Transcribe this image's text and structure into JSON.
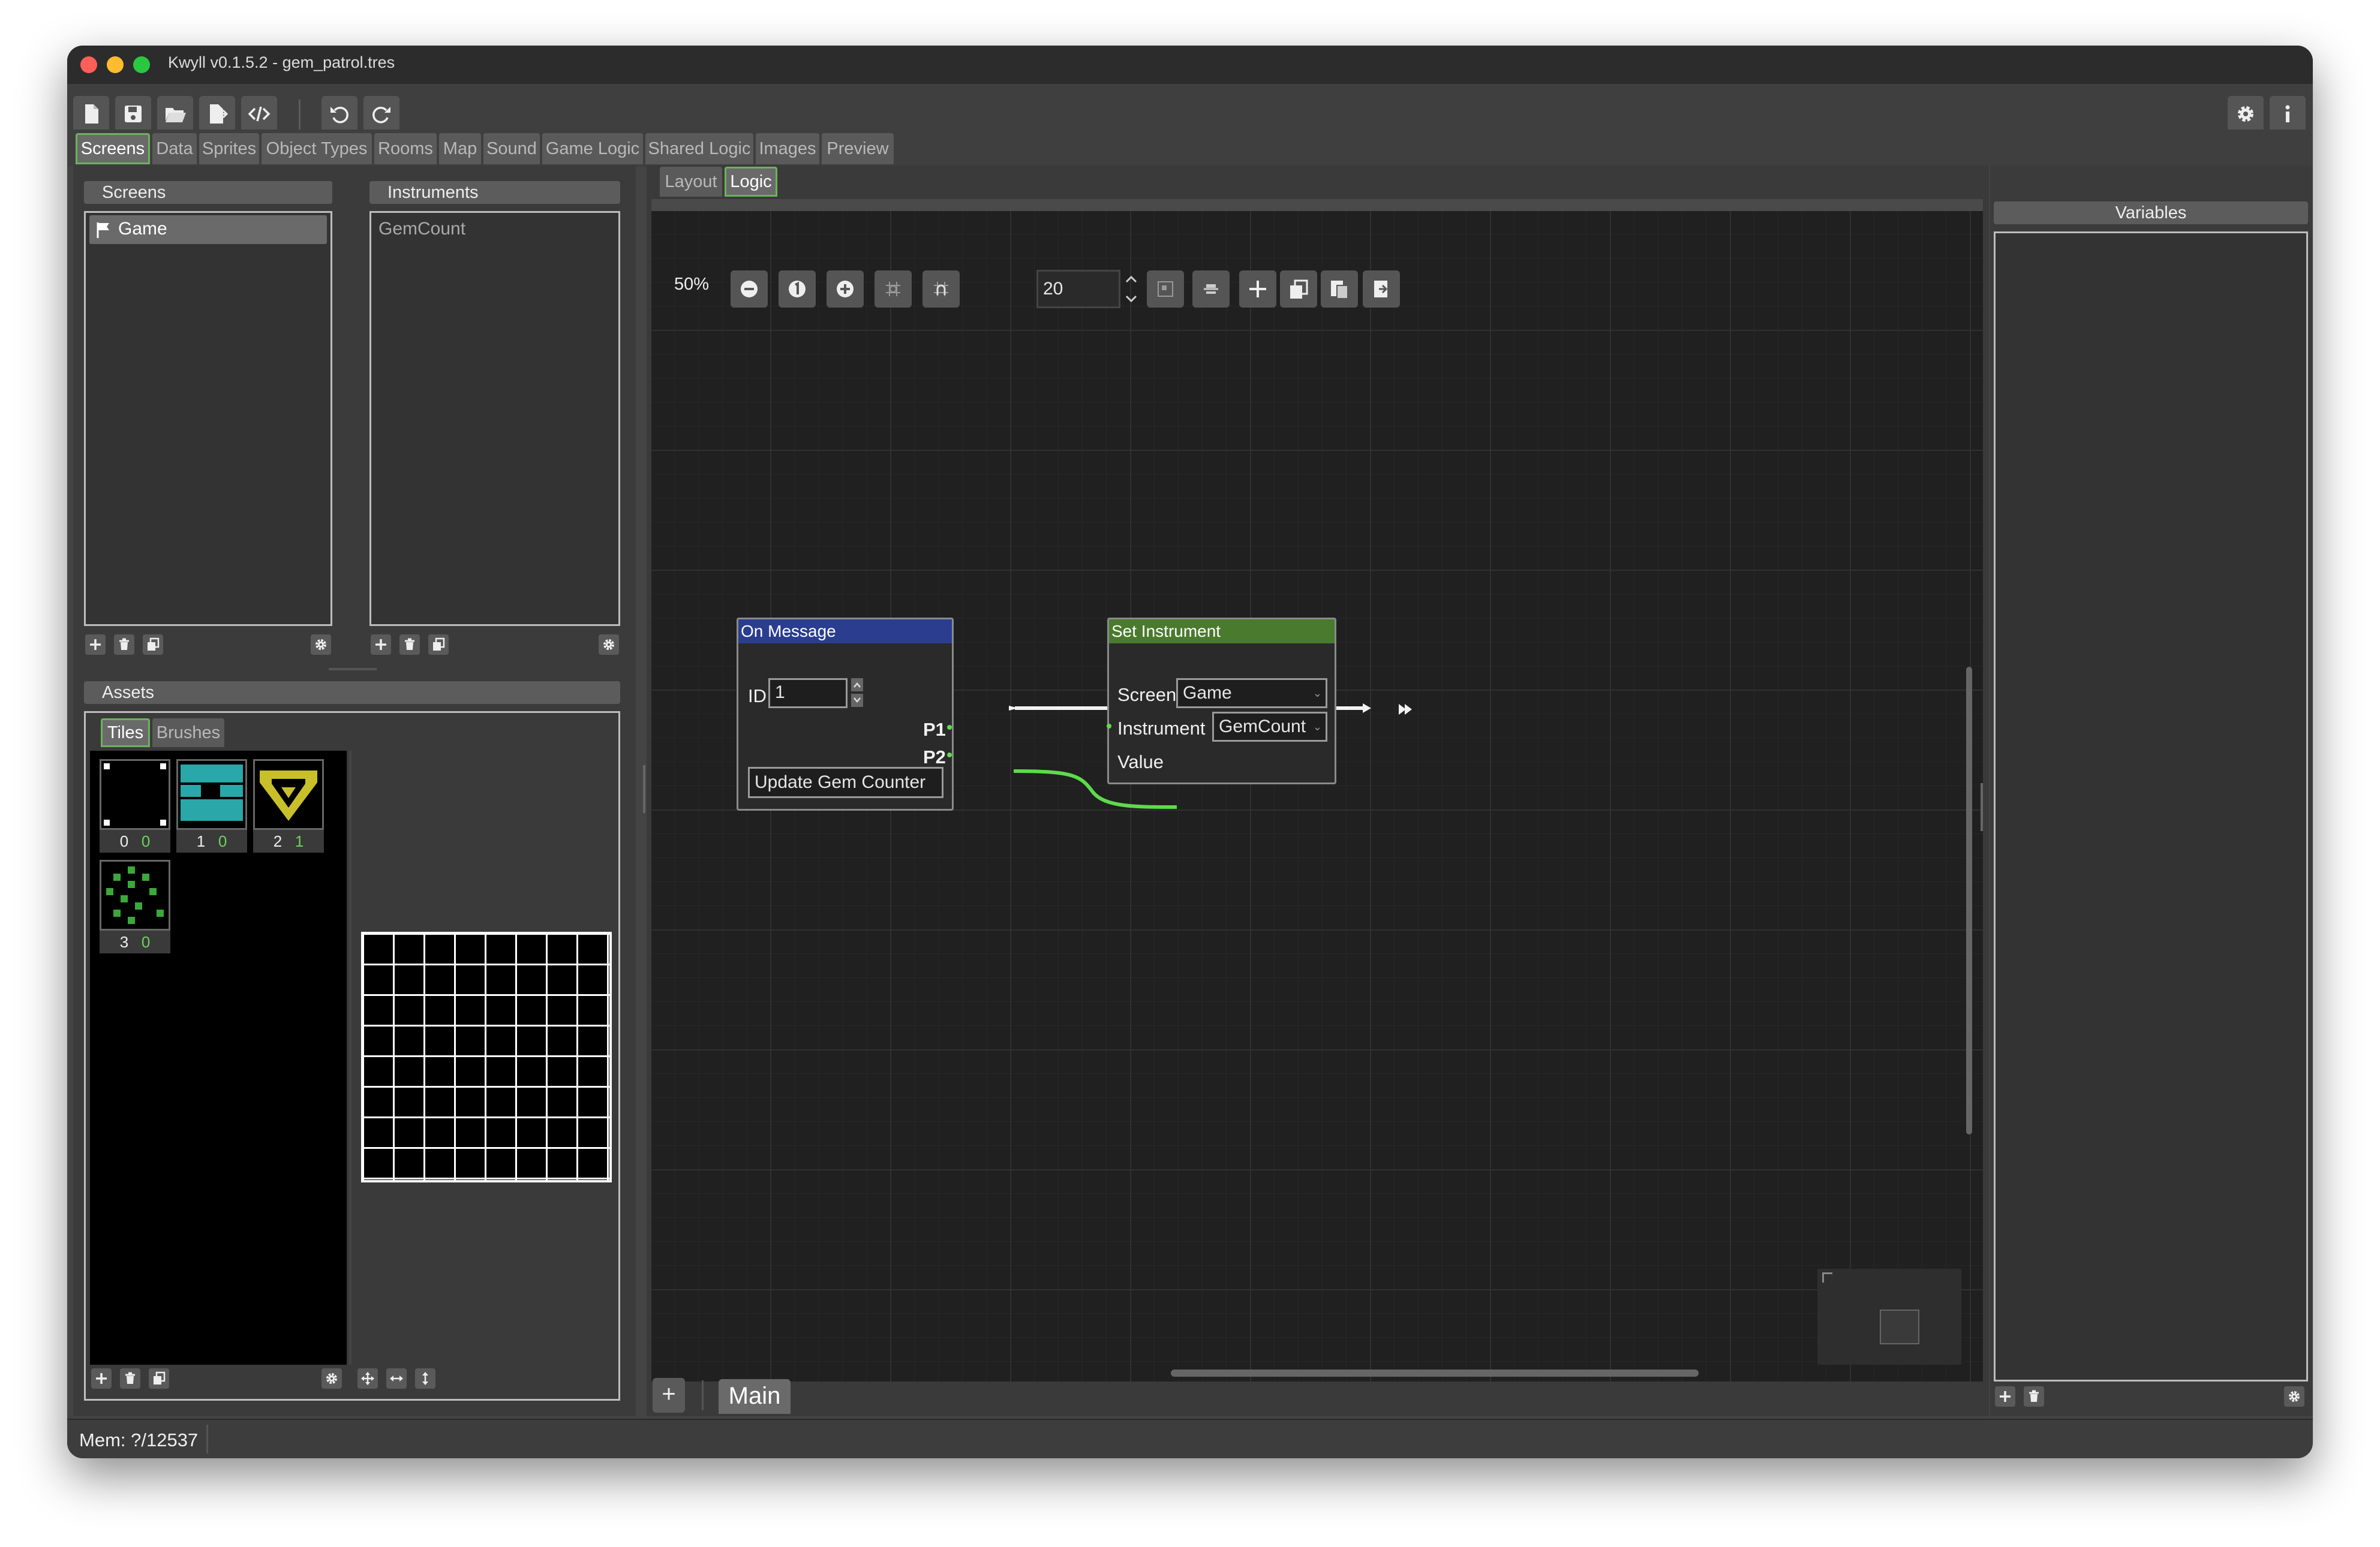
{
  "window": {
    "title": "Kwyll v0.1.5.2 - gem_patrol.tres"
  },
  "main_tabs": [
    {
      "label": "Screens",
      "active": true
    },
    {
      "label": "Data"
    },
    {
      "label": "Sprites"
    },
    {
      "label": "Object Types"
    },
    {
      "label": "Rooms"
    },
    {
      "label": "Map"
    },
    {
      "label": "Sound"
    },
    {
      "label": "Game Logic"
    },
    {
      "label": "Shared Logic"
    },
    {
      "label": "Images"
    },
    {
      "label": "Preview"
    }
  ],
  "screens_panel": {
    "title": "Screens",
    "items": [
      "Game"
    ]
  },
  "instruments_panel": {
    "title": "Instruments",
    "items": [
      "GemCount"
    ]
  },
  "assets_panel": {
    "title": "Assets",
    "tabs": [
      "Tiles",
      "Brushes"
    ],
    "tiles": [
      {
        "index": "0",
        "count": "0"
      },
      {
        "index": "1",
        "count": "0"
      },
      {
        "index": "2",
        "count": "1"
      },
      {
        "index": "3",
        "count": "0"
      }
    ]
  },
  "subtabs": [
    "Layout",
    "Logic"
  ],
  "graph_toolbar": {
    "zoom": "50%",
    "grid_size": "20"
  },
  "nodes": {
    "on_message": {
      "title": "On Message",
      "id_label": "ID",
      "id_value": "1",
      "p1": "P1",
      "p2": "P2",
      "comment": "Update Gem Counter"
    },
    "set_instrument": {
      "title": "Set Instrument",
      "screen_label": "Screen",
      "screen_value": "Game",
      "instrument_label": "Instrument",
      "instrument_value": "GemCount",
      "value_label": "Value"
    }
  },
  "graph_tabs": {
    "add": "+",
    "main": "Main"
  },
  "variables_panel": {
    "title": "Variables"
  },
  "status_bar": {
    "mem": "Mem: ?/12537"
  },
  "colors": {
    "on_message_header": "#2a3d8f",
    "set_instrument_header": "#4a7a2e",
    "accent": "#6db25d",
    "wire": "#5ddb4b"
  }
}
